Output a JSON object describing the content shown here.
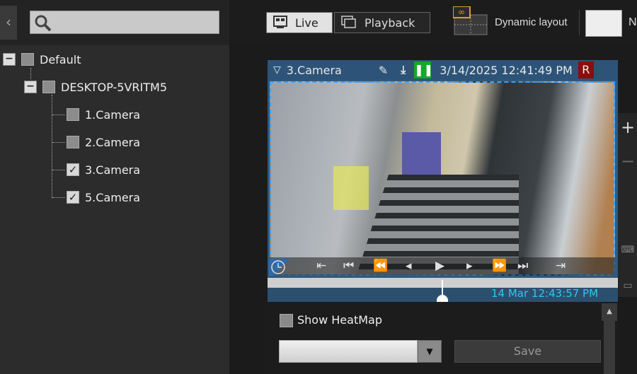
{
  "sidebar": {
    "search_placeholder": "",
    "tree": [
      {
        "label": "Default",
        "level": 0,
        "checked": false
      },
      {
        "label": "DESKTOP-5VRITM5",
        "level": 1,
        "checked": false
      },
      {
        "label": "1.Camera",
        "level": 2,
        "checked": false
      },
      {
        "label": "2.Camera",
        "level": 2,
        "checked": false
      },
      {
        "label": "3.Camera",
        "level": 2,
        "checked": true
      },
      {
        "label": "5.Camera",
        "level": 2,
        "checked": true
      }
    ]
  },
  "topbar": {
    "live": "Live",
    "playback": "Playback",
    "dynamic_layout": "Dynamic layout",
    "next_label": "N"
  },
  "camera": {
    "name": "3.Camera",
    "datetime": "3/14/2025 12:41:49 PM",
    "rec_badge": "R",
    "timeline_time": "14 Mar 12:43:57 PM",
    "colors": {
      "header": "#2d5478",
      "timestamp": "#2ec6f0",
      "pause": "#16a82a",
      "rec": "#8b0d0d"
    }
  },
  "panel": {
    "show_heatmap": "Show HeatMap",
    "heatmap_checked": false,
    "combo_value": "",
    "save": "Save"
  },
  "right_strip": {
    "zoom_in": "+",
    "zoom_out": "−"
  }
}
